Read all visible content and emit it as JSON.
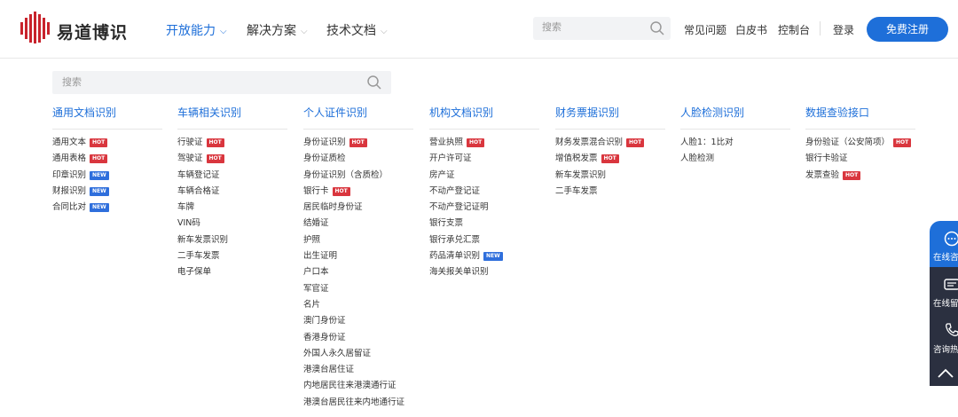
{
  "header": {
    "logo_text": "易道博识",
    "nav": [
      {
        "label": "开放能力",
        "active": true
      },
      {
        "label": "解决方案",
        "active": false
      },
      {
        "label": "技术文档",
        "active": false
      }
    ],
    "search_placeholder": "搜索",
    "links": [
      "常见问题",
      "白皮书",
      "控制台"
    ],
    "login": "登录",
    "signup": "免费注册"
  },
  "menu_search_placeholder": "搜索",
  "columns": [
    {
      "title": "通用文档识别",
      "items": [
        {
          "label": "通用文本",
          "badge": "HOT"
        },
        {
          "label": "通用表格",
          "badge": "HOT"
        },
        {
          "label": "印章识别",
          "badge": "NEW"
        },
        {
          "label": "财报识别",
          "badge": "NEW"
        },
        {
          "label": "合同比对",
          "badge": "NEW"
        }
      ]
    },
    {
      "title": "车辆相关识别",
      "items": [
        {
          "label": "行驶证",
          "badge": "HOT"
        },
        {
          "label": "驾驶证",
          "badge": "HOT"
        },
        {
          "label": "车辆登记证",
          "badge": ""
        },
        {
          "label": "车辆合格证",
          "badge": ""
        },
        {
          "label": "车牌",
          "badge": ""
        },
        {
          "label": "VIN码",
          "badge": ""
        },
        {
          "label": "新车发票识别",
          "badge": ""
        },
        {
          "label": "二手车发票",
          "badge": ""
        },
        {
          "label": "电子保单",
          "badge": ""
        }
      ]
    },
    {
      "title": "个人证件识别",
      "items": [
        {
          "label": "身份证识别",
          "badge": "HOT"
        },
        {
          "label": "身份证质检",
          "badge": ""
        },
        {
          "label": "身份证识别（含质检）",
          "badge": ""
        },
        {
          "label": "银行卡",
          "badge": "HOT"
        },
        {
          "label": "居民临时身份证",
          "badge": ""
        },
        {
          "label": "结婚证",
          "badge": ""
        },
        {
          "label": "护照",
          "badge": ""
        },
        {
          "label": "出生证明",
          "badge": ""
        },
        {
          "label": "户口本",
          "badge": ""
        },
        {
          "label": "军官证",
          "badge": ""
        },
        {
          "label": "名片",
          "badge": ""
        },
        {
          "label": "澳门身份证",
          "badge": ""
        },
        {
          "label": "香港身份证",
          "badge": ""
        },
        {
          "label": "外国人永久居留证",
          "badge": ""
        },
        {
          "label": "港澳台居住证",
          "badge": ""
        },
        {
          "label": "内地居民往来港澳通行证",
          "badge": ""
        },
        {
          "label": "港澳台居民往来内地通行证",
          "badge": ""
        }
      ]
    },
    {
      "title": "机构文档识别",
      "items": [
        {
          "label": "营业执照",
          "badge": "HOT"
        },
        {
          "label": "开户许可证",
          "badge": ""
        },
        {
          "label": "房产证",
          "badge": ""
        },
        {
          "label": "不动产登记证",
          "badge": ""
        },
        {
          "label": "不动产登记证明",
          "badge": ""
        },
        {
          "label": "银行支票",
          "badge": ""
        },
        {
          "label": "银行承兑汇票",
          "badge": ""
        },
        {
          "label": "药品清单识别",
          "badge": "NEW"
        },
        {
          "label": "海关报关单识别",
          "badge": ""
        }
      ]
    },
    {
      "title": "财务票据识别",
      "items": [
        {
          "label": "财务发票混合识别",
          "badge": "HOT"
        },
        {
          "label": "增值税发票",
          "badge": "HOT"
        },
        {
          "label": "新车发票识别",
          "badge": ""
        },
        {
          "label": "二手车发票",
          "badge": ""
        }
      ]
    },
    {
      "title": "人脸检测识别",
      "items": [
        {
          "label": "人脸1：1比对",
          "badge": ""
        },
        {
          "label": "人脸检测",
          "badge": ""
        }
      ]
    },
    {
      "title": "数据查验接口",
      "items": [
        {
          "label": "身份验证（公安简项）",
          "badge": "HOT"
        },
        {
          "label": "银行卡验证",
          "badge": ""
        },
        {
          "label": "发票查验",
          "badge": "HOT"
        }
      ]
    }
  ],
  "float_bar": {
    "items": [
      "在线咨",
      "在线留",
      "咨询热"
    ]
  },
  "colors": {
    "accent": "#1e6fd9",
    "hot": "#d9363e",
    "new": "#2f6fdc",
    "float_dark": "#2b3040"
  }
}
